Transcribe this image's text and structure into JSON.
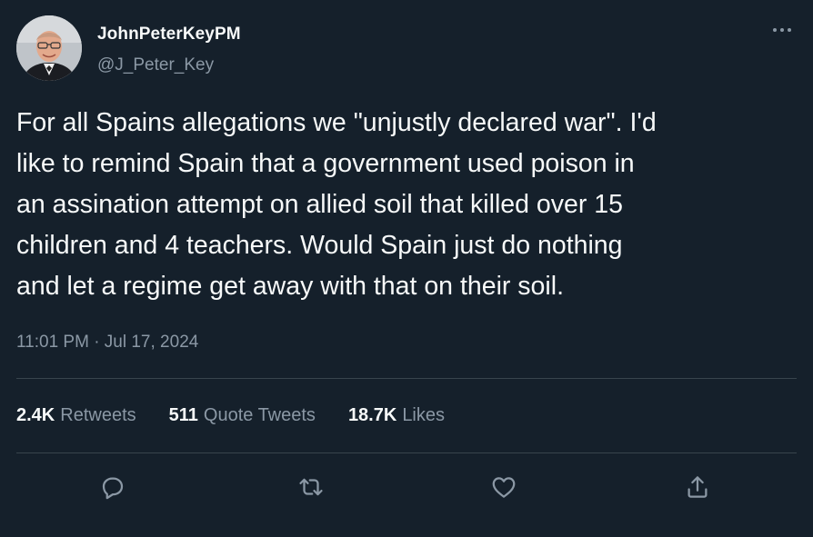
{
  "author": {
    "display_name": "JohnPeterKeyPM",
    "handle": "@J_Peter_Key"
  },
  "tweet": {
    "text": "For all Spains allegations we \"unjustly declared war\". I'd\nlike to remind Spain that a government used poison in\nan assination attempt on allied soil that killed over 15\nchildren and 4 teachers. Would Spain just do nothing\nand let a regime get away with that on their soil.",
    "timestamp": "11:01 PM · Jul 17, 2024"
  },
  "stats": [
    {
      "value": "2.4K",
      "label": "Retweets"
    },
    {
      "value": "511",
      "label": "Quote Tweets"
    },
    {
      "value": "18.7K",
      "label": "Likes"
    }
  ],
  "actions": [
    "reply-icon",
    "retweet-icon",
    "like-icon",
    "share-icon"
  ],
  "colors": {
    "background": "#15202b",
    "text": "#f7f9f9",
    "secondary_text": "#8b98a5",
    "divider": "#38444d"
  }
}
